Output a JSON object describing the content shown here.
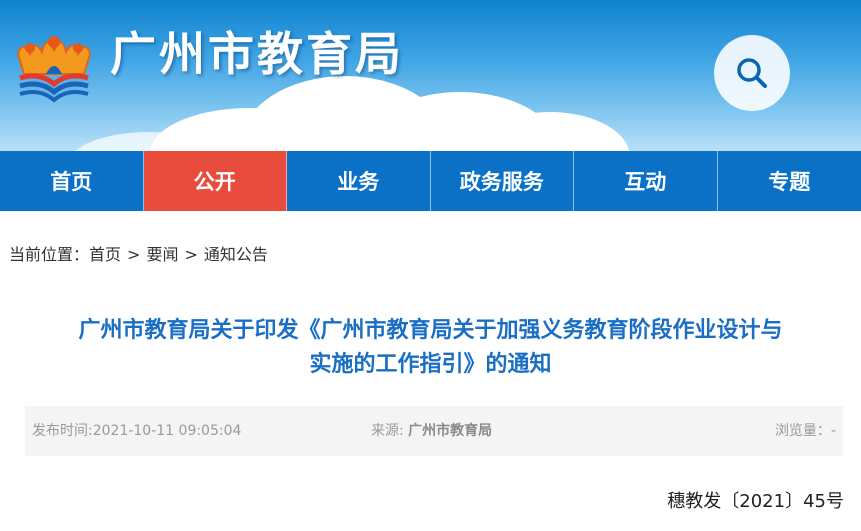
{
  "header": {
    "site_title": "广州市教育局",
    "logo_icon": "gz-education-logo",
    "search_icon": "search-icon"
  },
  "nav": {
    "items": [
      {
        "label": "首页",
        "active": false
      },
      {
        "label": "公开",
        "active": true
      },
      {
        "label": "业务",
        "active": false
      },
      {
        "label": "政务服务",
        "active": false
      },
      {
        "label": "互动",
        "active": false
      },
      {
        "label": "专题",
        "active": false
      }
    ]
  },
  "breadcrumb": {
    "prefix": "当前位置：",
    "items": [
      "首页",
      "要闻",
      "通知公告"
    ],
    "separator": ">"
  },
  "article": {
    "title_line1": "广州市教育局关于印发《广州市教育局关于加强义务教育阶段作业设计与",
    "title_line2": "实施的工作指引》的通知",
    "publish_label": "发布时间:",
    "publish_time": "2021-10-11 09:05:04",
    "source_label": "来源:",
    "source_value": "广州市教育局",
    "views_label": "浏览量：",
    "views_value": "-",
    "doc_number": "穗教发〔2021〕45号"
  },
  "colors": {
    "nav_bg": "#0a71c6",
    "nav_active": "#e84c3d",
    "title_blue": "#1a6fc4"
  }
}
